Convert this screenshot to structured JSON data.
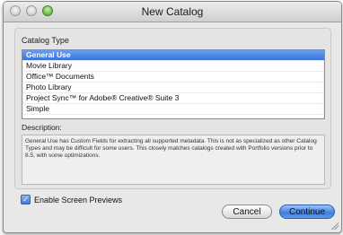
{
  "window": {
    "title": "New Catalog"
  },
  "catalog_type": {
    "label": "Catalog Type",
    "items": [
      {
        "label": "General Use",
        "selected": true
      },
      {
        "label": "Movie Library",
        "selected": false
      },
      {
        "label": "Office™ Documents",
        "selected": false
      },
      {
        "label": "Photo Library",
        "selected": false
      },
      {
        "label": "Project Sync™ for Adobe® Creative® Suite 3",
        "selected": false
      },
      {
        "label": "Simple",
        "selected": false
      }
    ]
  },
  "description": {
    "label": "Description:",
    "text": "General Use has Custom Fields for extracting all supported metadata. This is not as specialized as other Catalog Types and may be difficult for some users. This closely matches catalogs created with Portfolio versions prior to 8.5, with some optimizations."
  },
  "options": {
    "enable_previews_label": "Enable Screen Previews",
    "enable_previews_checked": true
  },
  "buttons": {
    "cancel_label": "Cancel",
    "continue_label": "Continue"
  },
  "colors": {
    "selection": "#3b73d8",
    "default_button": "#3d7ee0"
  }
}
